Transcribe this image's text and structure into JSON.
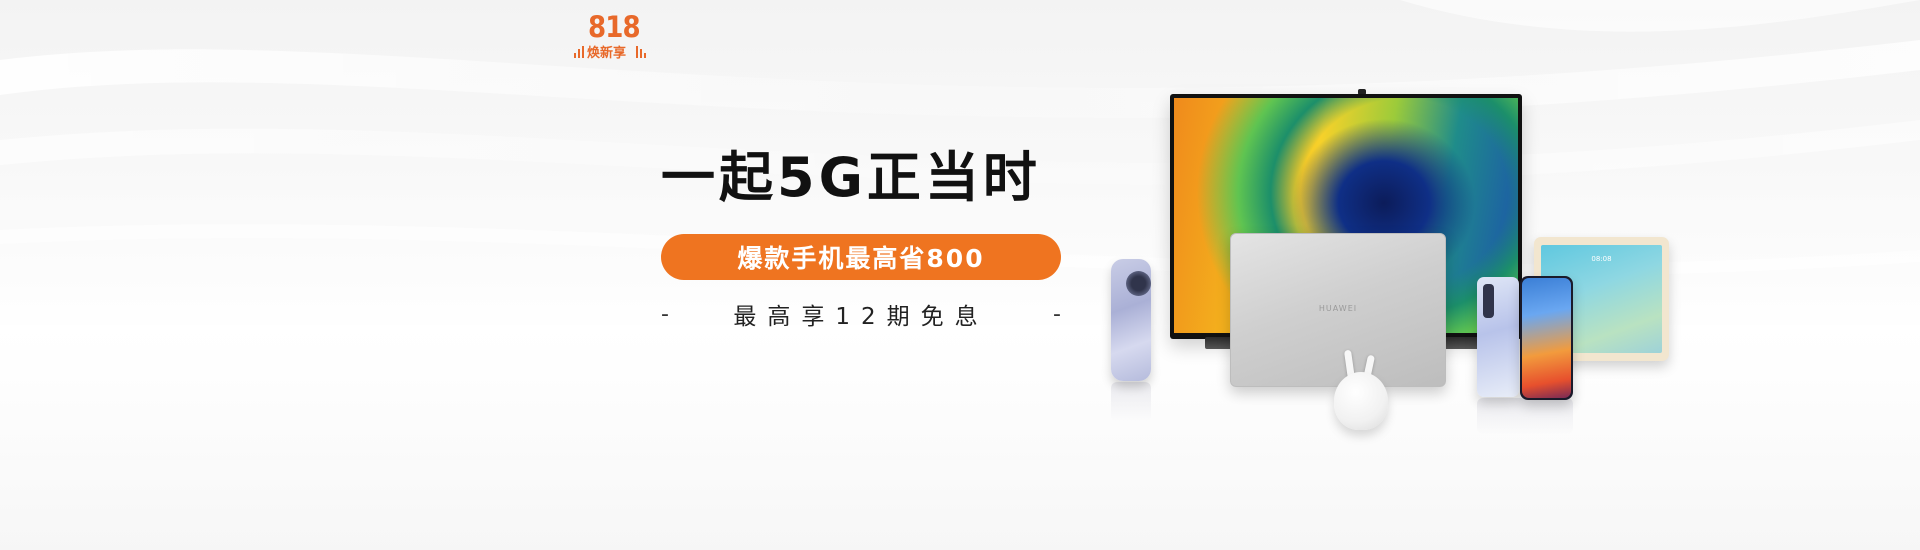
{
  "campaign_logo": {
    "number": "818",
    "subtitle": "焕新享",
    "accent_color": "#e8692a"
  },
  "headline": "一起5G正当时",
  "promo": {
    "label": "爆款手机最高省800",
    "pill_color": "#ef7420"
  },
  "installment": {
    "left_dash": "-",
    "text": "最高享12期免息",
    "right_dash": "-"
  },
  "products": {
    "laptop_brand": "HUAWEI",
    "tablet_clock": "08:08",
    "items": [
      "mate-phone",
      "smart-screen-tv",
      "laptop",
      "freebuds-earbuds",
      "p40-phone",
      "matepad-tablet"
    ]
  }
}
